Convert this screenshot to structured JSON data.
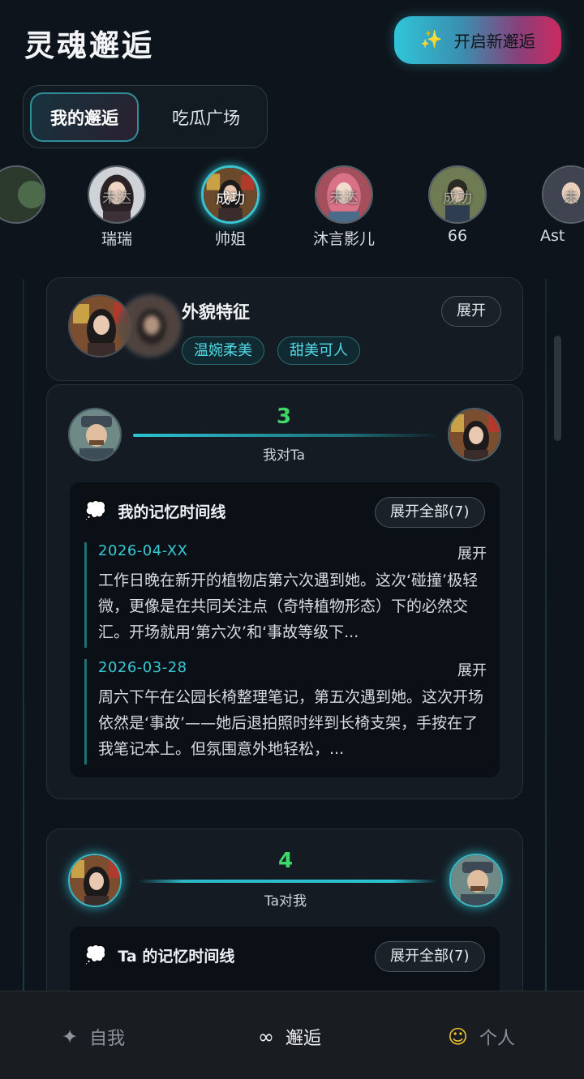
{
  "header": {
    "title": "灵魂邂逅",
    "new_button": "开启新邂逅"
  },
  "tabs": [
    {
      "label": "我的邂逅",
      "active": true
    },
    {
      "label": "吃瓜广场",
      "active": false
    }
  ],
  "contacts": [
    {
      "name": "瑞瑞",
      "status": "未达"
    },
    {
      "name": "帅姐",
      "status": "成功",
      "selected": true
    },
    {
      "name": "沐言影儿",
      "status": "未达"
    },
    {
      "name": "66",
      "status": "成功"
    },
    {
      "name": "Ast",
      "status": "未"
    }
  ],
  "appearance": {
    "title": "外貌特征",
    "expand": "展开",
    "tags": [
      "温婉柔美",
      "甜美可人"
    ]
  },
  "my_to_ta": {
    "score": "3",
    "label": "我对Ta",
    "timeline_title": "我的记忆时间线",
    "expand_all": "展开全部(7)",
    "entries": [
      {
        "date": "2026-04-XX",
        "expand": "展开",
        "text": "工作日晚在新开的植物店第六次遇到她。这次‘碰撞’极轻微，更像是在共同关注点（奇特植物形态）下的必然交汇。开场就用‘第六次’和‘事故等级下..."
      },
      {
        "date": "2026-03-28",
        "expand": "展开",
        "text": "周六下午在公园长椅整理笔记，第五次遇到她。这次开场依然是‘事故’——她后退拍照时绊到长椅支架，手按在了我笔记本上。但氛围意外地轻松，..."
      }
    ]
  },
  "ta_to_me": {
    "score": "4",
    "label": "Ta对我",
    "timeline_title": "Ta 的记忆时间线",
    "expand_all": "展开全部(7)"
  },
  "nav": [
    {
      "label": "自我",
      "icon": "sparkle-icon"
    },
    {
      "label": "邂逅",
      "icon": "infinity-icon"
    },
    {
      "label": "个人",
      "icon": "smile-icon"
    }
  ],
  "colors": {
    "accent": "#39c6d2",
    "score": "#3fd66a",
    "bg": "#0e141b"
  }
}
